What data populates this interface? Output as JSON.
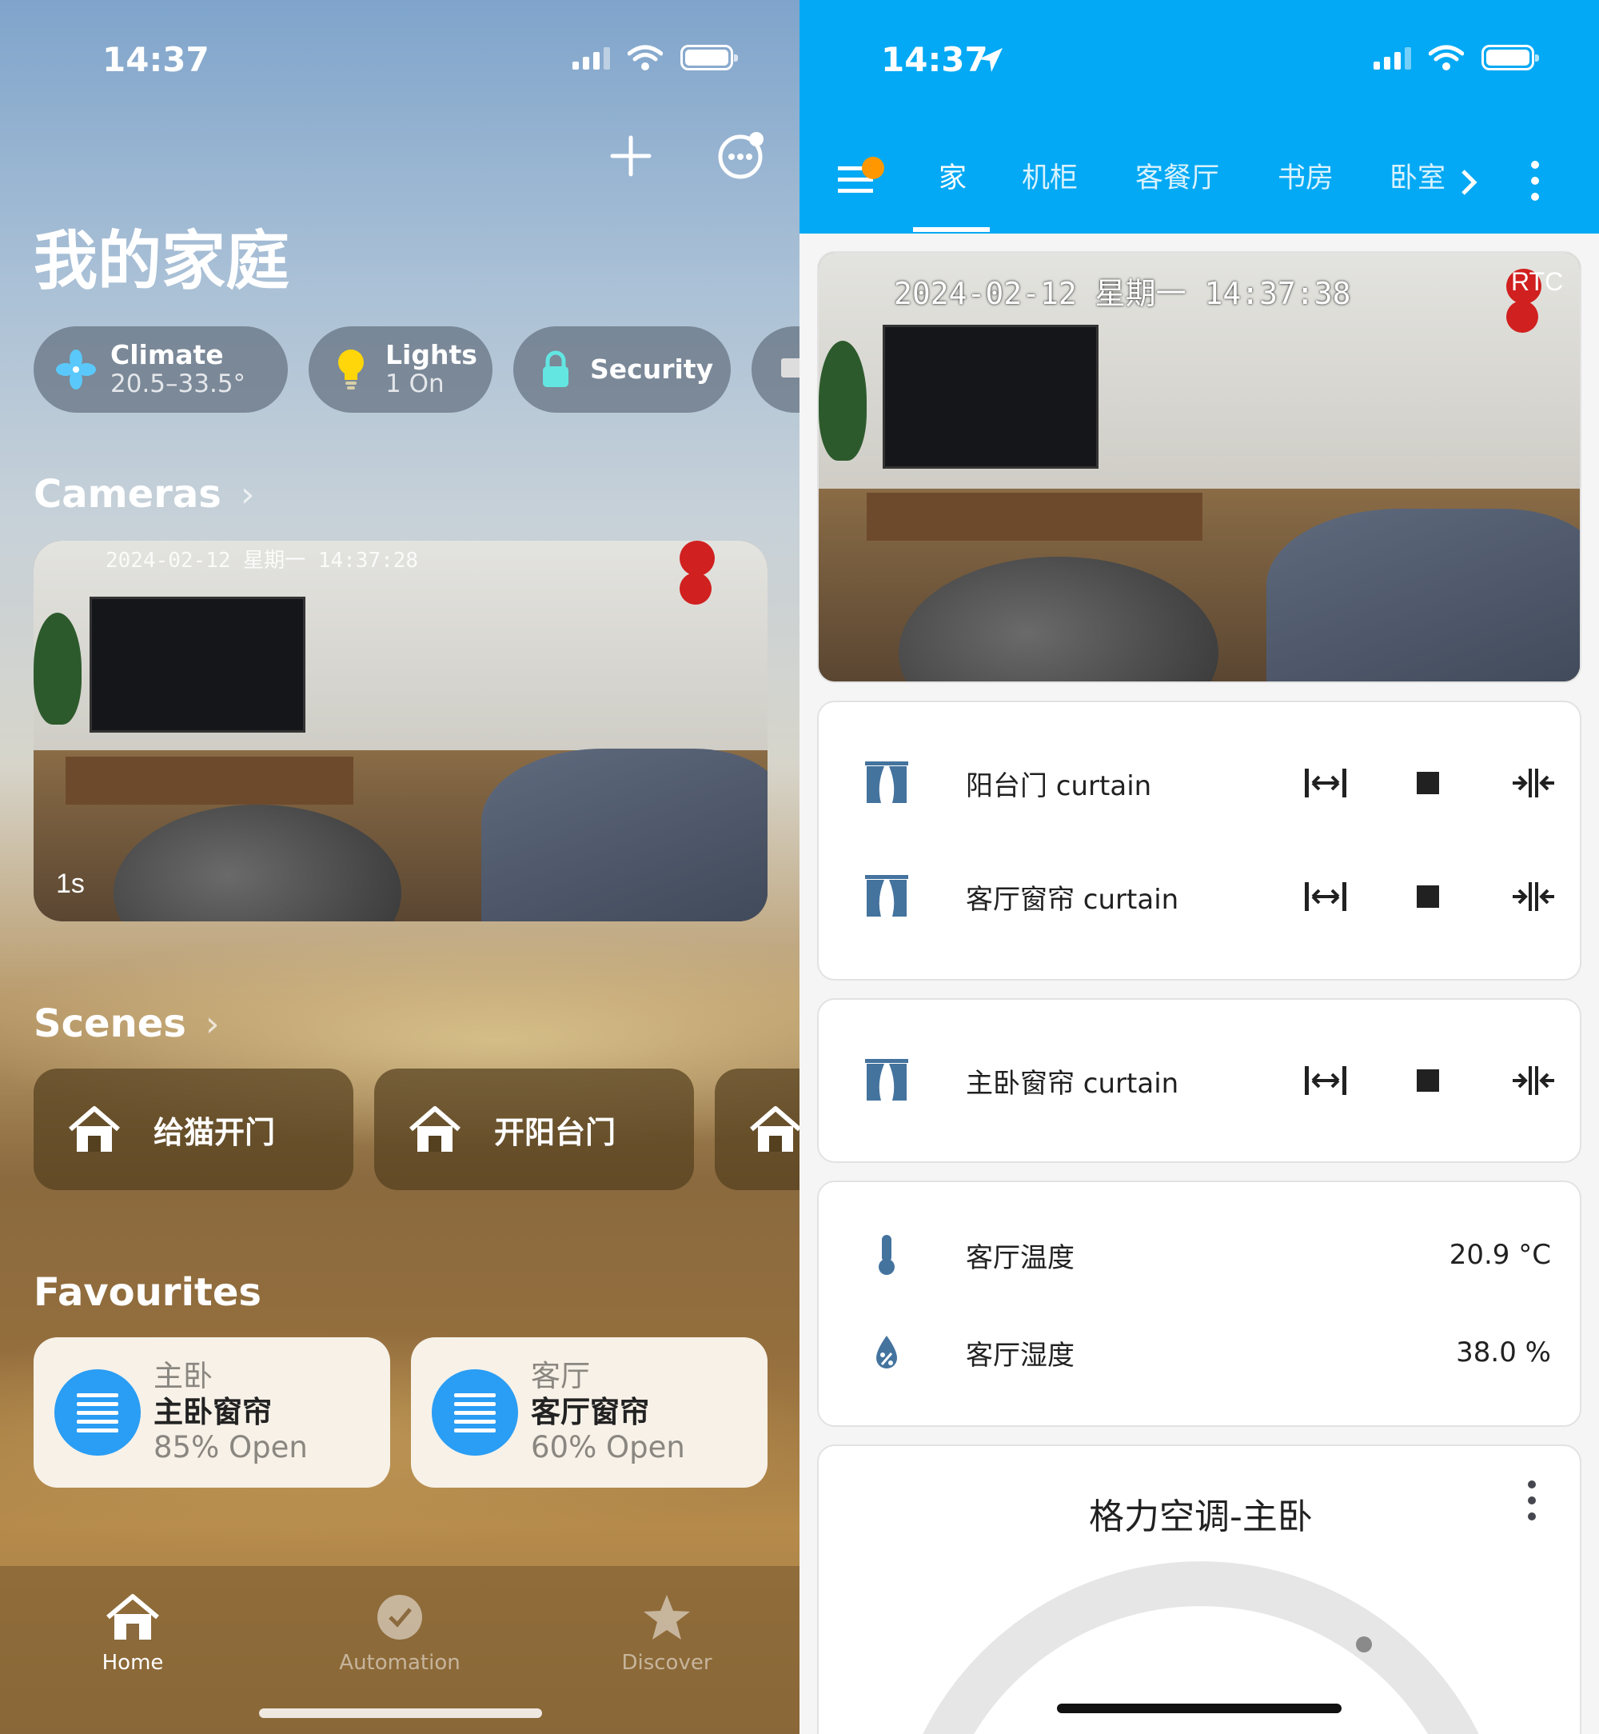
{
  "left": {
    "status_time": "14:37",
    "title": "我的家庭",
    "chips": [
      {
        "label": "Climate",
        "sub": "20.5–33.5°",
        "icon": "fan-icon",
        "color": "#5ac8fa"
      },
      {
        "label": "Lights",
        "sub": "1 On",
        "icon": "lightbulb-icon",
        "color": "#ffd60a"
      },
      {
        "label": "Security",
        "sub": "",
        "icon": "lock-icon",
        "color": "#63e6e2"
      }
    ],
    "cameras_header": "Cameras",
    "camera": {
      "timestamp": "2024-02-12 星期一 14:37:28",
      "age": "1s"
    },
    "scenes_header": "Scenes",
    "scenes": [
      {
        "label": "给猫开门"
      },
      {
        "label": "开阳台门"
      }
    ],
    "favourites_header": "Favourites",
    "favourites": [
      {
        "room": "主卧",
        "name": "主卧窗帘",
        "status": "85% Open"
      },
      {
        "room": "客厅",
        "name": "客厅窗帘",
        "status": "60% Open"
      }
    ],
    "tabs": [
      {
        "label": "Home",
        "icon": "house-icon",
        "active": true
      },
      {
        "label": "Automation",
        "icon": "checkmark-clock-icon",
        "active": false
      },
      {
        "label": "Discover",
        "icon": "star-icon",
        "active": false
      }
    ]
  },
  "right": {
    "status_time": "14:37",
    "tabs": [
      "家",
      "机柜",
      "客餐厅",
      "书房",
      "卧室"
    ],
    "active_tab": "家",
    "camera": {
      "timestamp": "2024-02-12 星期一 14:37:38",
      "badge": "RTC"
    },
    "curtain_card_1": [
      {
        "name": "阳台门 curtain"
      },
      {
        "name": "客厅窗帘 curtain"
      }
    ],
    "curtain_card_2": [
      {
        "name": "主卧窗帘 curtain"
      }
    ],
    "sensors": [
      {
        "name": "客厅温度",
        "value": "20.9 °C",
        "icon": "thermometer-icon"
      },
      {
        "name": "客厅湿度",
        "value": "38.0 %",
        "icon": "water-percent-icon"
      }
    ],
    "climate_card": {
      "title": "格力空调-主卧"
    },
    "colors": {
      "header": "#03a9f4",
      "icon_blue": "#44739e",
      "badge": "#ff9800"
    }
  }
}
